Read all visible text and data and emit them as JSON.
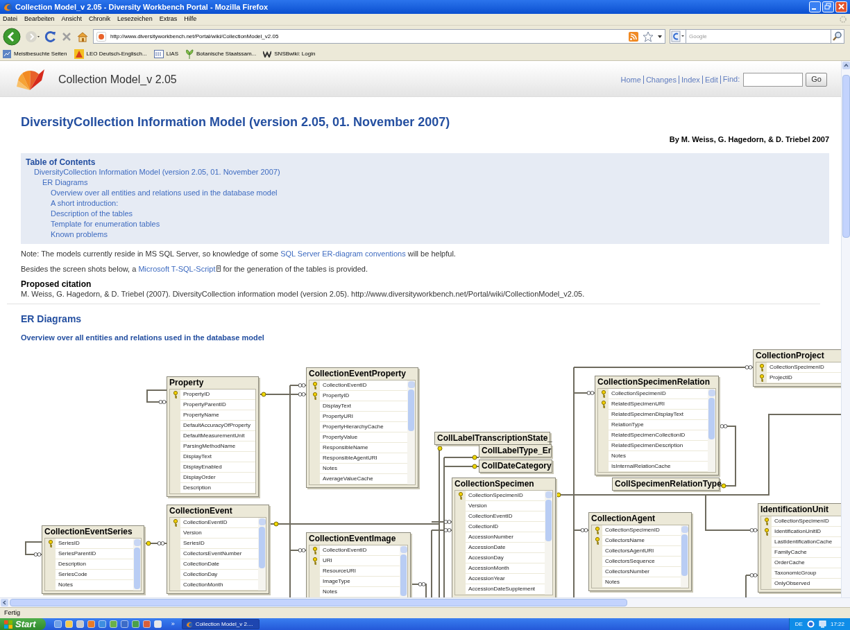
{
  "window": {
    "title": "Collection Model_v 2.05 - Diversity Workbench Portal - Mozilla Firefox"
  },
  "menu_bar": [
    "Datei",
    "Bearbeiten",
    "Ansicht",
    "Chronik",
    "Lesezeichen",
    "Extras",
    "Hilfe"
  ],
  "navigation": {
    "url": "http://www.diversityworkbench.net/Portal/wiki/CollectionModel_v2.05",
    "search_placeholder": "Google"
  },
  "bookmarks": [
    "Meistbesuchte Seiten",
    "LEO Deutsch-Englisch...",
    "LIAS",
    "Botanische Staatssam...",
    "SNSBwiki: Login"
  ],
  "page": {
    "site_title": "Collection Model_v 2.05",
    "header_links": [
      "Home",
      "Changes",
      "Index",
      "Edit"
    ],
    "find_label": "Find:",
    "go_button": "Go",
    "heading": "DiversityCollection Information Model (version 2.05, 01. November 2007)",
    "byline": "By M. Weiss, G. Hagedorn, & D. Triebel 2007",
    "toc": {
      "title": "Table of Contents",
      "items": [
        {
          "text": "DiversityCollection Information Model (version 2.05, 01. November 2007)",
          "children": [
            {
              "text": "ER Diagrams",
              "children": [
                {
                  "text": "Overview over all entities and relations used in the database model"
                },
                {
                  "text": "A short introduction:"
                },
                {
                  "text": "Description of the tables"
                },
                {
                  "text": "Template for enumeration tables"
                },
                {
                  "text": "Known problems"
                }
              ]
            }
          ]
        }
      ]
    },
    "paragraphs": [
      [
        {
          "kind": "text",
          "text": "Note: The models currently reside in MS SQL Server, so knowledge of some "
        },
        {
          "kind": "link",
          "text": "SQL Server ER-diagram conventions",
          "attachment": false
        },
        {
          "kind": "text",
          "text": " will be helpful."
        }
      ],
      [
        {
          "kind": "text",
          "text": "Besides the screen shots below, a "
        },
        {
          "kind": "link",
          "text": "Microsoft T-SQL-Script",
          "attachment": true
        },
        {
          "kind": "text",
          "text": " for the generation of the tables is provided."
        }
      ]
    ],
    "citation_label": "Proposed citation",
    "citation": "M. Weiss, G. Hagedorn, & D. Triebel (2007). DiversityCollection information model (version 2.05). http://www.diversityworkbench.net/Portal/wiki/CollectionModel_v2.05.",
    "section_heading": "ER Diagrams",
    "subheading": "Overview over all entities and relations used in the database model",
    "diagram": {
      "tables": [
        {
          "name": "CollectionEventSeries",
          "scrollbar": true,
          "columns": [
            {
              "name": "SeriesID",
              "key": true
            },
            {
              "name": "SeriesParentID",
              "key": false
            },
            {
              "name": "Description",
              "key": false
            },
            {
              "name": "SeriesCode",
              "key": false
            },
            {
              "name": "Notes",
              "key": false
            }
          ]
        },
        {
          "name": "Property",
          "scrollbar": false,
          "columns": [
            {
              "name": "PropertyID",
              "key": true
            },
            {
              "name": "PropertyParentID",
              "key": false
            },
            {
              "name": "PropertyName",
              "key": false
            },
            {
              "name": "DefaultAccuracyOfProperty",
              "key": false
            },
            {
              "name": "DefaultMeasurementUnit",
              "key": false
            },
            {
              "name": "ParsingMethodName",
              "key": false
            },
            {
              "name": "DisplayText",
              "key": false
            },
            {
              "name": "DisplayEnabled",
              "key": false
            },
            {
              "name": "DisplayOrder",
              "key": false
            },
            {
              "name": "Description",
              "key": false
            }
          ]
        },
        {
          "name": "CollectionEvent",
          "scrollbar": true,
          "columns": [
            {
              "name": "CollectionEventID",
              "key": true
            },
            {
              "name": "Version",
              "key": false
            },
            {
              "name": "SeriesID",
              "key": false
            },
            {
              "name": "CollectorsEventNumber",
              "key": false
            },
            {
              "name": "CollectionDate",
              "key": false
            },
            {
              "name": "CollectionDay",
              "key": false
            },
            {
              "name": "CollectionMonth",
              "key": false
            }
          ]
        },
        {
          "name": "CollectionEventProperty",
          "scrollbar": true,
          "columns": [
            {
              "name": "CollectionEventID",
              "key": true
            },
            {
              "name": "PropertyID",
              "key": true
            },
            {
              "name": "DisplayText",
              "key": false
            },
            {
              "name": "PropertyURI",
              "key": false
            },
            {
              "name": "PropertyHierarchyCache",
              "key": false
            },
            {
              "name": "PropertyValue",
              "key": false
            },
            {
              "name": "ResponsibleName",
              "key": false
            },
            {
              "name": "ResponsibleAgentURI",
              "key": false
            },
            {
              "name": "Notes",
              "key": false
            },
            {
              "name": "AverageValueCache",
              "key": false
            }
          ]
        },
        {
          "name": "CollectionEventImage",
          "scrollbar": true,
          "columns": [
            {
              "name": "CollectionEventID",
              "key": true
            },
            {
              "name": "URI",
              "key": true
            },
            {
              "name": "ResourceURI",
              "key": false
            },
            {
              "name": "ImageType",
              "key": false
            },
            {
              "name": "Notes",
              "key": false
            }
          ]
        },
        {
          "name": "CollLabelTranscriptionState_",
          "scrollbar": false
        },
        {
          "name": "CollLabelType_Er",
          "scrollbar": false
        },
        {
          "name": "CollDateCategory",
          "scrollbar": false
        },
        {
          "name": "CollectionSpecimen",
          "scrollbar": true,
          "columns": [
            {
              "name": "CollectionSpecimenID",
              "key": true
            },
            {
              "name": "Version",
              "key": false
            },
            {
              "name": "CollectionEventID",
              "key": false
            },
            {
              "name": "CollectionID",
              "key": false
            },
            {
              "name": "AccessionNumber",
              "key": false
            },
            {
              "name": "AccessionDate",
              "key": false
            },
            {
              "name": "AccessionDay",
              "key": false
            },
            {
              "name": "AccessionMonth",
              "key": false
            },
            {
              "name": "AccessionYear",
              "key": false
            },
            {
              "name": "AccessionDateSupplement",
              "key": false
            }
          ]
        },
        {
          "name": "CollectionSpecimenRelation",
          "scrollbar": true,
          "columns": [
            {
              "name": "CollectionSpecimenID",
              "key": true
            },
            {
              "name": "RelatedSpecimenURI",
              "key": true
            },
            {
              "name": "RelatedSpecimenDisplayText",
              "key": false
            },
            {
              "name": "RelationType",
              "key": false
            },
            {
              "name": "RelatedSpecimenCollectionID",
              "key": false
            },
            {
              "name": "RelatedSpecimenDescription",
              "key": false
            },
            {
              "name": "Notes",
              "key": false
            },
            {
              "name": "IsInternalRelationCache",
              "key": false
            }
          ]
        },
        {
          "name": "CollSpecimenRelationType",
          "scrollbar": false
        },
        {
          "name": "CollectionAgent",
          "scrollbar": true,
          "columns": [
            {
              "name": "CollectionSpecimenID",
              "key": true
            },
            {
              "name": "CollectorsName",
              "key": true
            },
            {
              "name": "CollectorsAgentURI",
              "key": false
            },
            {
              "name": "CollectorsSequence",
              "key": false
            },
            {
              "name": "CollectorsNumber",
              "key": false
            },
            {
              "name": "Notes",
              "key": false
            }
          ]
        },
        {
          "name": "CollectionProject",
          "scrollbar": false,
          "columns": [
            {
              "name": "CollectionSpecimenID",
              "key": true
            },
            {
              "name": "ProjectID",
              "key": true
            }
          ]
        },
        {
          "name": "IdentificationUnit",
          "scrollbar": false,
          "columns": [
            {
              "name": "CollectionSpecimenID",
              "key": true
            },
            {
              "name": "IdentificationUnitID",
              "key": true
            },
            {
              "name": "LastIdentificationCache",
              "key": false
            },
            {
              "name": "FamilyCache",
              "key": false
            },
            {
              "name": "OrderCache",
              "key": false
            },
            {
              "name": "TaxonomicGroup",
              "key": false
            },
            {
              "name": "OnlyObserved",
              "key": false
            }
          ]
        }
      ]
    }
  },
  "status_bar": "Fertig",
  "taskbar": {
    "start": "Start",
    "more": "»",
    "tasks": [
      {
        "label": "Collection Model_v 2....",
        "selected": true
      }
    ],
    "language": "DE",
    "clock": "17:22"
  }
}
